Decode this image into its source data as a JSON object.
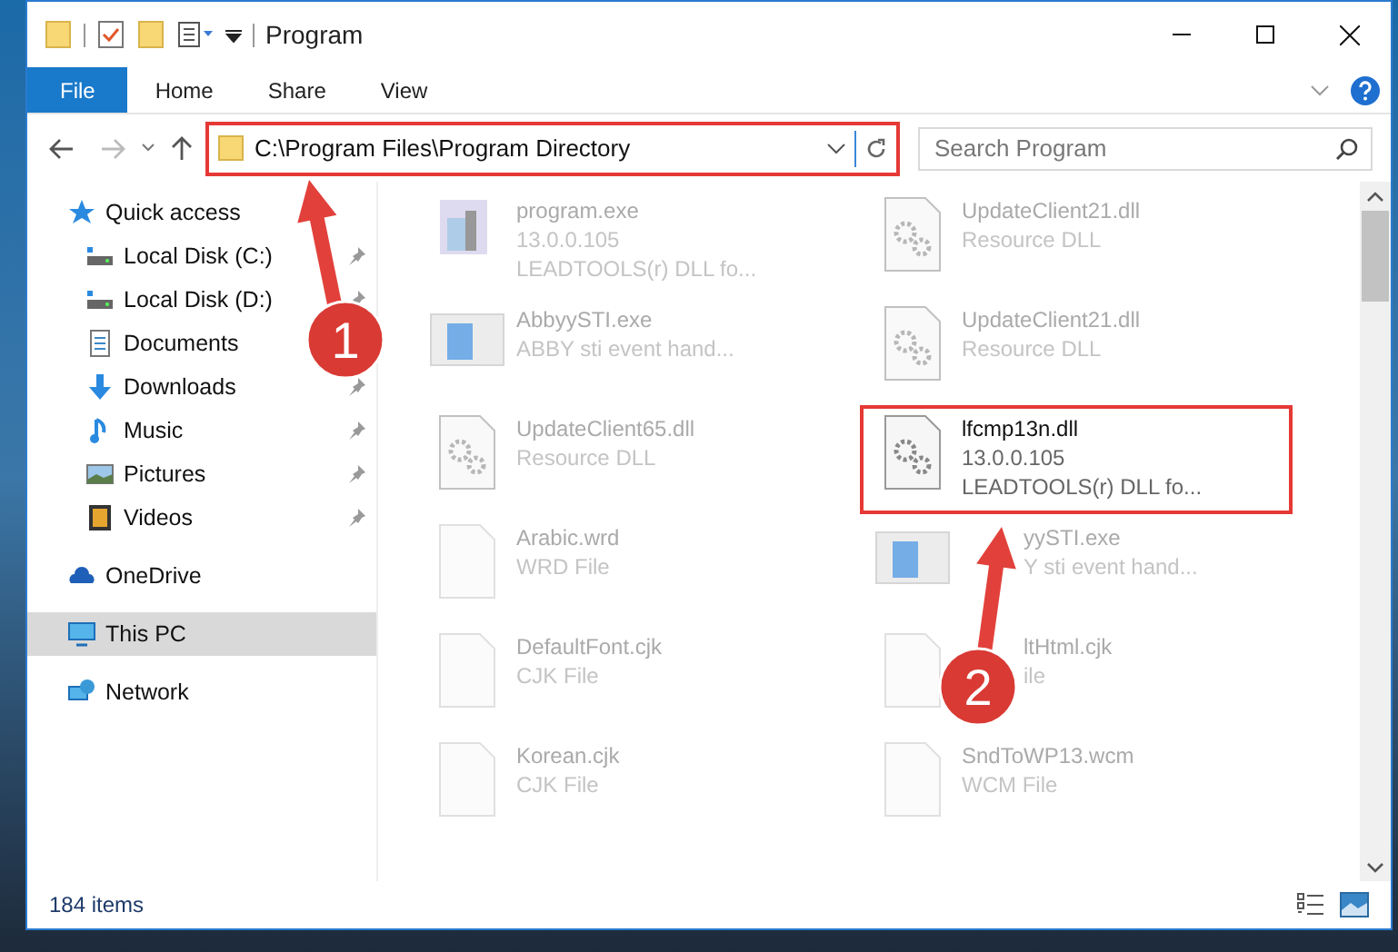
{
  "window": {
    "title": "Program"
  },
  "ribbon_tabs": [
    {
      "label": "File",
      "selected": true
    },
    {
      "label": "Home",
      "selected": false
    },
    {
      "label": "Share",
      "selected": false
    },
    {
      "label": "View",
      "selected": false
    }
  ],
  "address": {
    "path": "C:\\Program Files\\Program Directory",
    "highlighted": true
  },
  "search": {
    "placeholder": "Search Program"
  },
  "sidebar": {
    "items": [
      {
        "label": "Quick access",
        "kind": "quick",
        "pinned": false,
        "selected": false,
        "children": [
          {
            "label": "Local Disk (C:)",
            "kind": "disk",
            "pinned": true,
            "selected": false
          },
          {
            "label": "Local Disk (D:)",
            "kind": "disk",
            "pinned": true,
            "selected": false
          },
          {
            "label": "Documents",
            "kind": "documents",
            "pinned": false,
            "selected": false
          },
          {
            "label": "Downloads",
            "kind": "downloads",
            "pinned": true,
            "selected": false
          },
          {
            "label": "Music",
            "kind": "music",
            "pinned": true,
            "selected": false
          },
          {
            "label": "Pictures",
            "kind": "pictures",
            "pinned": true,
            "selected": false
          },
          {
            "label": "Videos",
            "kind": "videos",
            "pinned": true,
            "selected": false
          }
        ]
      },
      {
        "label": "OneDrive",
        "kind": "cloud",
        "pinned": false,
        "selected": false
      },
      {
        "label": "This PC",
        "kind": "pc",
        "pinned": false,
        "selected": true
      },
      {
        "label": "Network",
        "kind": "network",
        "pinned": false,
        "selected": false
      }
    ]
  },
  "files": [
    {
      "name": "program.exe",
      "lines": [
        "13.0.0.105",
        "LEADTOOLS(r) DLL fo..."
      ],
      "kind": "app",
      "highlighted": false,
      "covered": false
    },
    {
      "name": "UpdateClient21.dll",
      "lines": [
        "Resource DLL"
      ],
      "kind": "dll",
      "highlighted": false,
      "covered": false
    },
    {
      "name": "AbbyySTI.exe",
      "lines": [
        "ABBY sti event hand..."
      ],
      "kind": "window",
      "highlighted": false,
      "covered": false
    },
    {
      "name": "UpdateClient21.dll",
      "lines": [
        "Resource DLL"
      ],
      "kind": "dll",
      "highlighted": false,
      "covered": false
    },
    {
      "name": "UpdateClient65.dll",
      "lines": [
        "Resource DLL"
      ],
      "kind": "dll",
      "highlighted": false,
      "covered": false
    },
    {
      "name": "lfcmp13n.dll",
      "lines": [
        "13.0.0.105",
        "LEADTOOLS(r) DLL fo..."
      ],
      "kind": "dll",
      "highlighted": true,
      "covered": false
    },
    {
      "name": "Arabic.wrd",
      "lines": [
        "WRD File"
      ],
      "kind": "file",
      "highlighted": false,
      "covered": false
    },
    {
      "name": "yySTI.exe",
      "lines": [
        "Y sti event hand..."
      ],
      "kind": "window",
      "highlighted": false,
      "covered": true
    },
    {
      "name": "DefaultFont.cjk",
      "lines": [
        "CJK File"
      ],
      "kind": "file",
      "highlighted": false,
      "covered": false
    },
    {
      "name": "ltHtml.cjk",
      "lines": [
        "ile"
      ],
      "kind": "file",
      "highlighted": false,
      "covered": true
    },
    {
      "name": "Korean.cjk",
      "lines": [
        "CJK File"
      ],
      "kind": "file",
      "highlighted": false,
      "covered": false
    },
    {
      "name": "SndToWP13.wcm",
      "lines": [
        "WCM File"
      ],
      "kind": "file",
      "highlighted": false,
      "covered": false
    }
  ],
  "status_bar": {
    "count": "184 items"
  },
  "annotations": [
    {
      "label": "1"
    },
    {
      "label": "2"
    }
  ]
}
